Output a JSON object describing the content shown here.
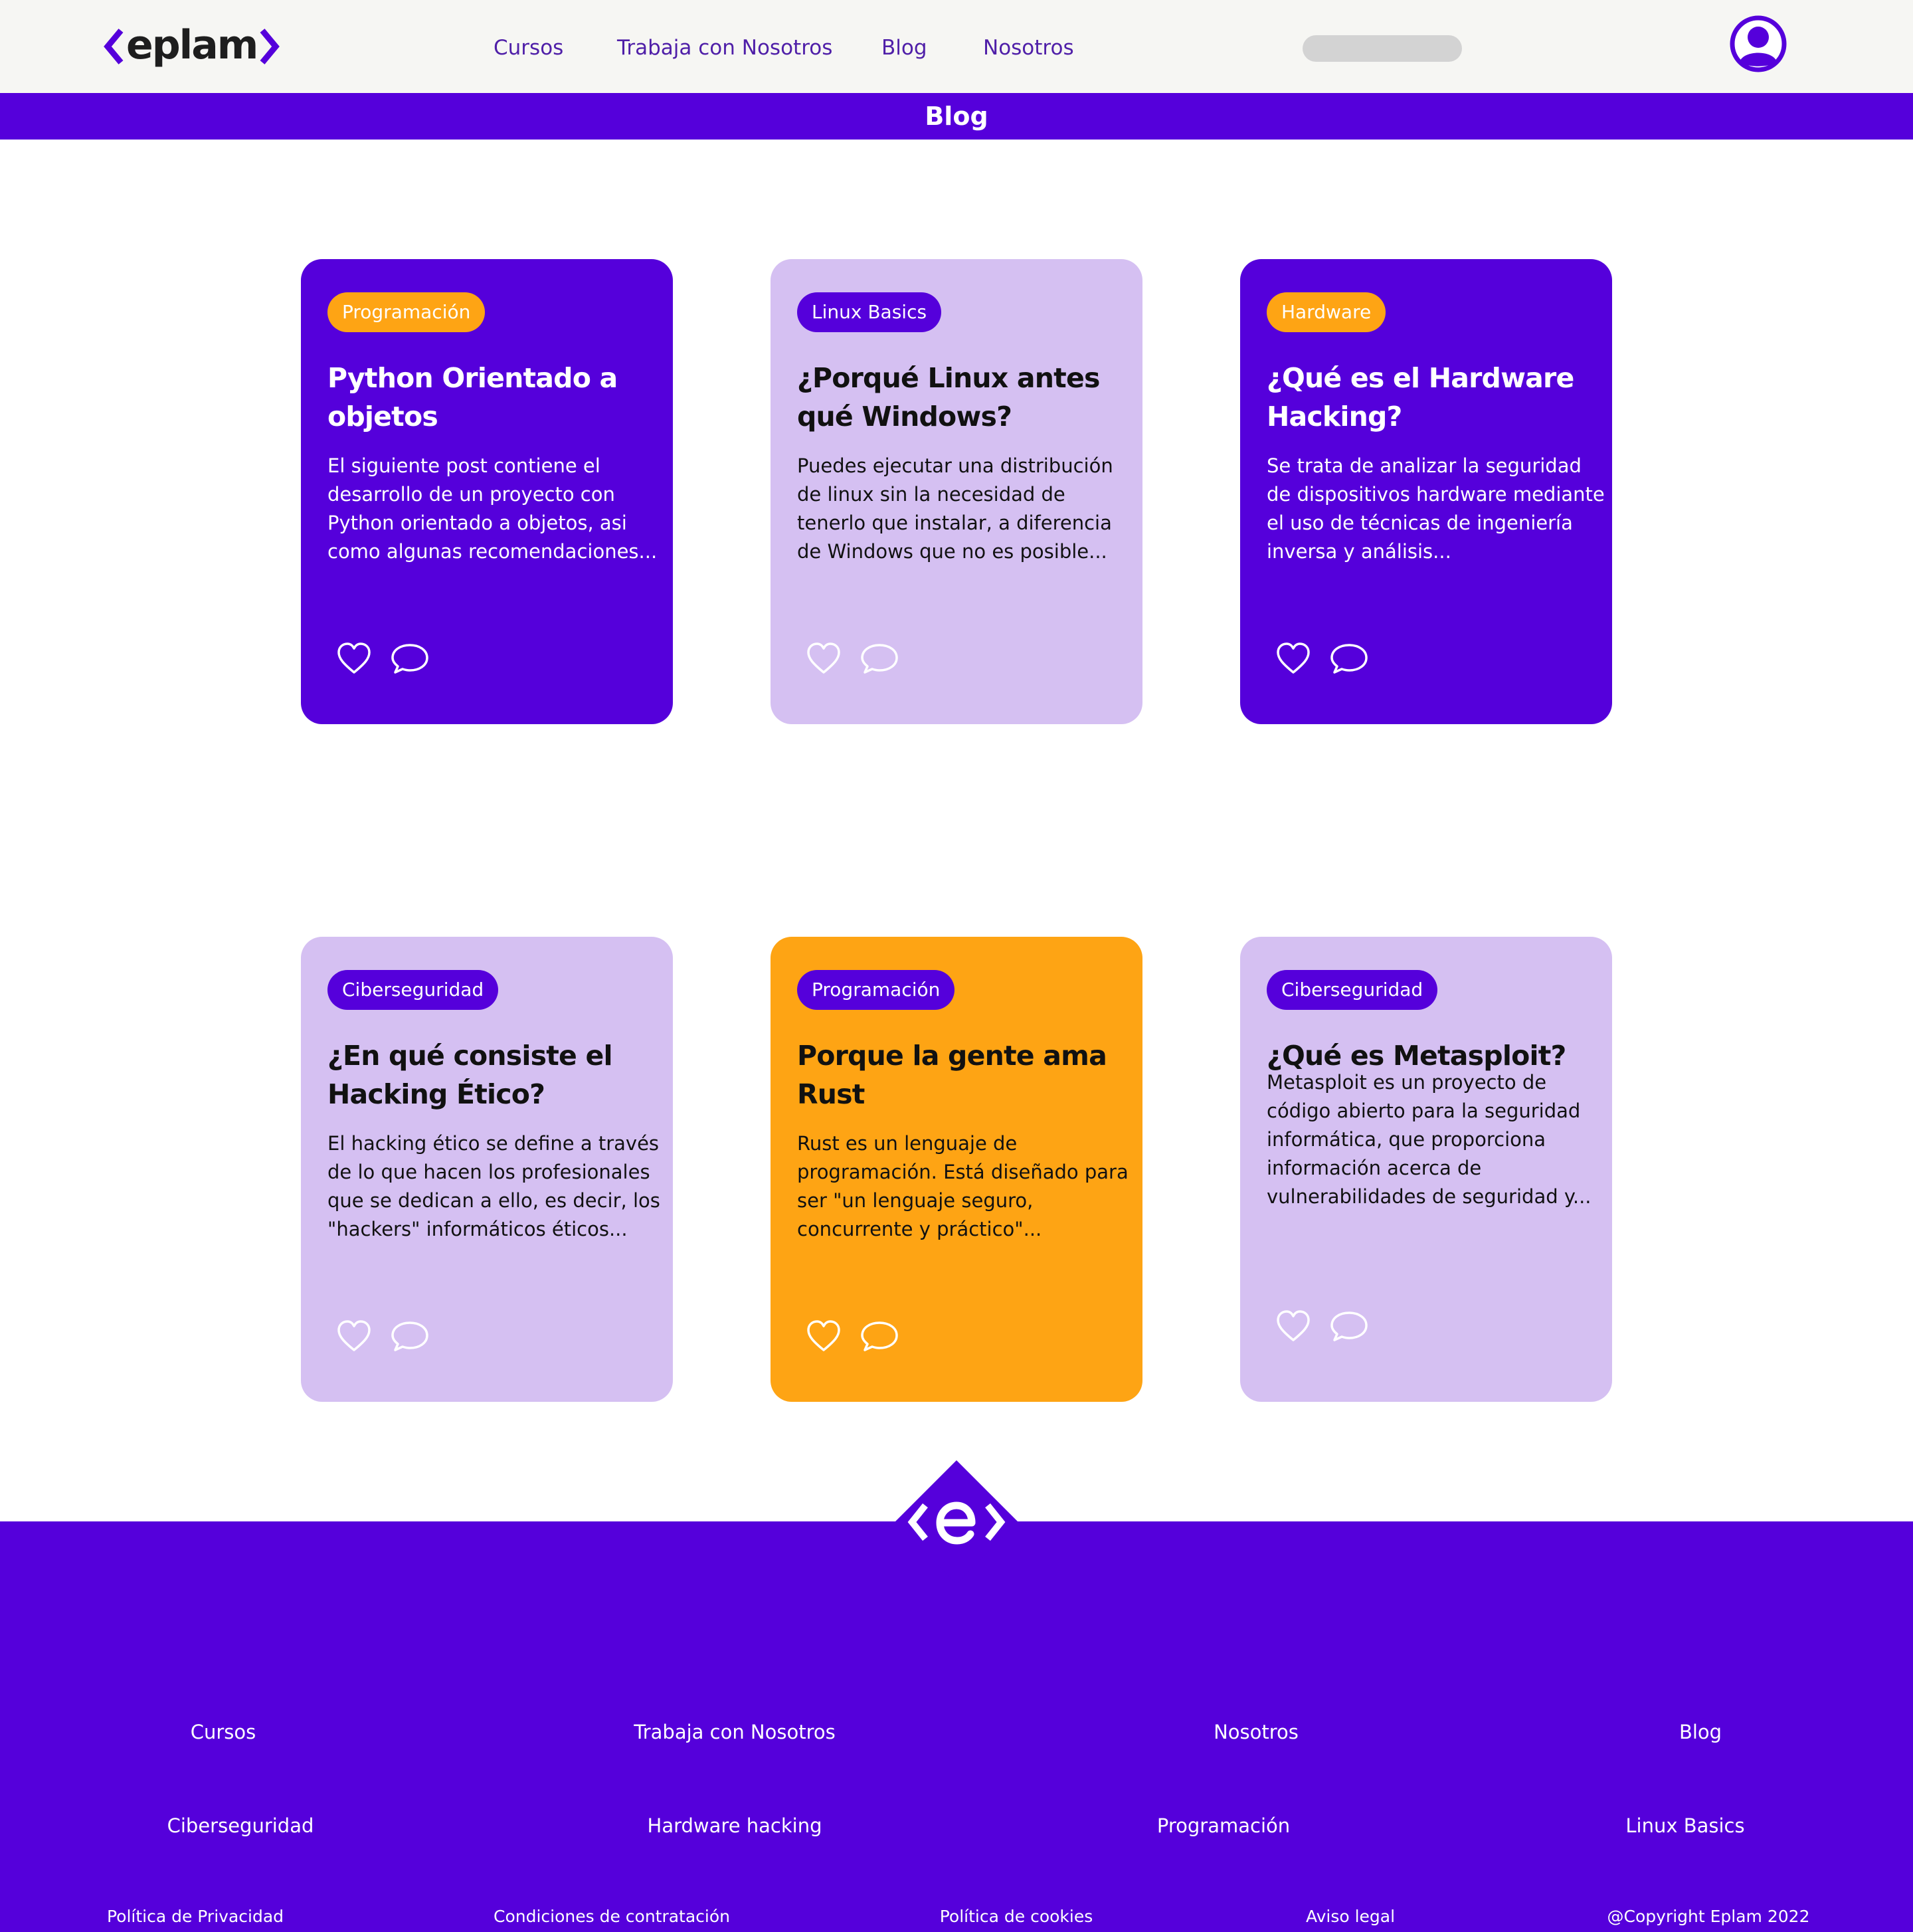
{
  "brand": {
    "logo_text": "eplam",
    "accent": "#5500db",
    "orange": "#fea414",
    "lilac": "#d5c0f2"
  },
  "nav": {
    "items": [
      "Cursos",
      "Trabaja con Nosotros",
      "Blog",
      "Nosotros"
    ],
    "search_value": "",
    "profile_icon": "user-icon"
  },
  "banner": {
    "title": "Blog"
  },
  "posts": [
    {
      "tag": "Programación",
      "tag_color": "orange",
      "card_color": "purple",
      "title": "Python Orientado a objetos",
      "excerpt": "El siguiente post contiene el desarrollo de un proyecto con Python orientado a objetos, asi como algunas recomendaciones..."
    },
    {
      "tag": "Linux Basics",
      "tag_color": "purple",
      "card_color": "lilac",
      "title": "¿Porqué Linux antes qué Windows?",
      "excerpt": "Puedes ejecutar una distribución de linux sin la necesidad de tenerlo que instalar, a diferencia de Windows que no es posible..."
    },
    {
      "tag": "Hardware",
      "tag_color": "orange",
      "card_color": "purple",
      "title": "¿Qué es el Hardware Hacking?",
      "excerpt": "Se trata de analizar la seguridad de dispositivos hardware mediante el uso de técnicas de ingeniería inversa y análisis..."
    },
    {
      "tag": "Ciberseguridad",
      "tag_color": "purple",
      "card_color": "lilac",
      "title": "¿En qué consiste el Hacking Ético?",
      "excerpt": "El hacking ético se define a través de lo que hacen los profesionales que se dedican a ello, es decir, los \"hackers\" informáticos éticos..."
    },
    {
      "tag": "Programación",
      "tag_color": "purple",
      "card_color": "orange",
      "title": "Porque la gente ama Rust",
      "excerpt": "Rust es un lenguaje de programación. Está diseñado para ser \"un lenguaje seguro, concurrente y práctico\"..."
    },
    {
      "tag": "Ciberseguridad",
      "tag_color": "purple",
      "card_color": "lilac",
      "title": "¿Qué es Metasploit?",
      "excerpt": "Metasploit es un proyecto de código abierto para la seguridad informática, que proporciona información acerca de vulnerabilidades de seguridad y..."
    }
  ],
  "card_icons": [
    "heart-icon",
    "comment-icon"
  ],
  "footer": {
    "row1": [
      "Cursos",
      "Trabaja con Nosotros",
      "Nosotros",
      "Blog"
    ],
    "row2": [
      "Ciberseguridad",
      "Hardware hacking",
      "Programación",
      "Linux Basics"
    ],
    "row3": [
      "Política de Privacidad",
      "Condiciones de contratación",
      "Política de cookies",
      "Aviso legal",
      "@Copyright Eplam 2022"
    ]
  }
}
